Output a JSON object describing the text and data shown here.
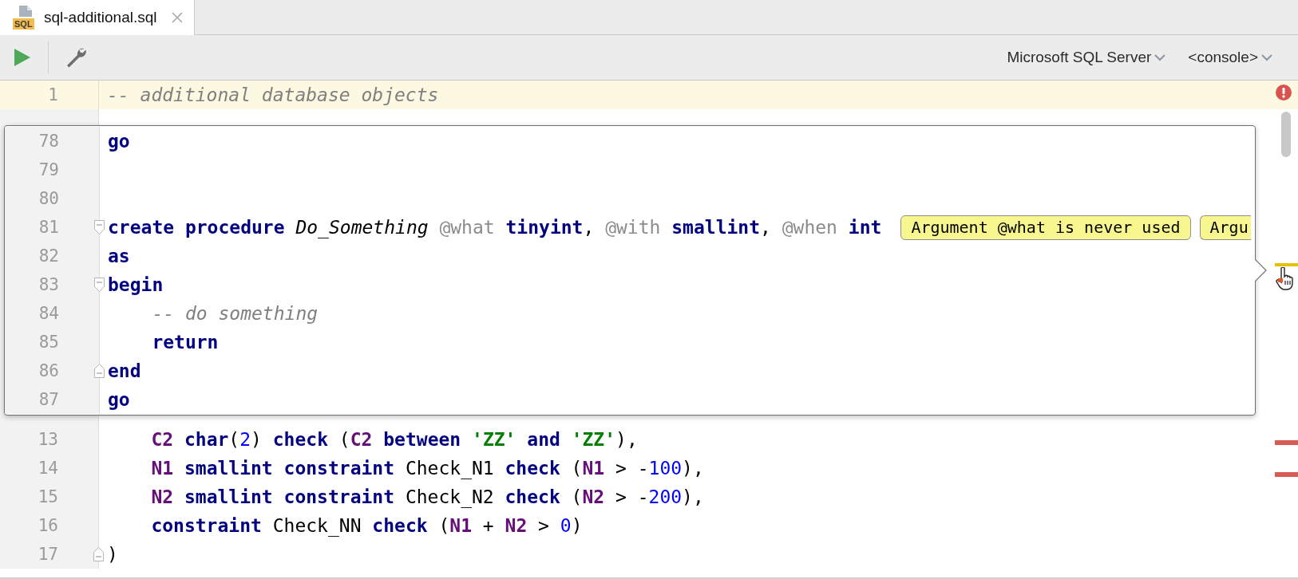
{
  "tab": {
    "title": "sql-additional.sql",
    "icon_label": "SQL",
    "selected": true
  },
  "toolbar": {
    "datasource": "Microsoft SQL Server",
    "session": "<console>"
  },
  "editor": {
    "lines_above": [
      {
        "number": "1",
        "current": true,
        "tokens": [
          {
            "kind": "comment",
            "text": "-- additional database objects"
          }
        ]
      }
    ],
    "lines_below": [
      {
        "number": "13",
        "current": false,
        "tokens": [
          {
            "kind": "column",
            "text": "    C2 "
          },
          {
            "kind": "keyword",
            "text": "char"
          },
          {
            "kind": "plain",
            "text": "("
          },
          {
            "kind": "number",
            "text": "2"
          },
          {
            "kind": "plain",
            "text": ") "
          },
          {
            "kind": "keyword",
            "text": "check "
          },
          {
            "kind": "plain",
            "text": "("
          },
          {
            "kind": "column",
            "text": "C2 "
          },
          {
            "kind": "keyword",
            "text": "between "
          },
          {
            "kind": "string",
            "text": "'ZZ' "
          },
          {
            "kind": "keyword",
            "text": "and "
          },
          {
            "kind": "string",
            "text": "'ZZ'"
          },
          {
            "kind": "plain",
            "text": "),"
          }
        ]
      },
      {
        "number": "14",
        "current": false,
        "tokens": [
          {
            "kind": "column",
            "text": "    N1 "
          },
          {
            "kind": "keyword",
            "text": "smallint constraint "
          },
          {
            "kind": "plain",
            "text": "Check_N1 "
          },
          {
            "kind": "keyword",
            "text": "check "
          },
          {
            "kind": "plain",
            "text": "("
          },
          {
            "kind": "column",
            "text": "N1 "
          },
          {
            "kind": "plain",
            "text": "> -"
          },
          {
            "kind": "number",
            "text": "100"
          },
          {
            "kind": "plain",
            "text": "),"
          }
        ]
      },
      {
        "number": "15",
        "current": false,
        "tokens": [
          {
            "kind": "column",
            "text": "    N2 "
          },
          {
            "kind": "keyword",
            "text": "smallint constraint "
          },
          {
            "kind": "plain",
            "text": "Check_N2 "
          },
          {
            "kind": "keyword",
            "text": "check "
          },
          {
            "kind": "plain",
            "text": "("
          },
          {
            "kind": "column",
            "text": "N2 "
          },
          {
            "kind": "plain",
            "text": "> -"
          },
          {
            "kind": "number",
            "text": "200"
          },
          {
            "kind": "plain",
            "text": "),"
          }
        ]
      },
      {
        "number": "16",
        "current": false,
        "tokens": [
          {
            "kind": "keyword",
            "text": "    constraint "
          },
          {
            "kind": "plain",
            "text": "Check_NN "
          },
          {
            "kind": "keyword",
            "text": "check "
          },
          {
            "kind": "plain",
            "text": "("
          },
          {
            "kind": "column",
            "text": "N1 "
          },
          {
            "kind": "plain",
            "text": "+ "
          },
          {
            "kind": "column",
            "text": "N2 "
          },
          {
            "kind": "plain",
            "text": "> "
          },
          {
            "kind": "number",
            "text": "0"
          },
          {
            "kind": "plain",
            "text": ")"
          }
        ]
      },
      {
        "number": "17",
        "current": false,
        "fold_end": true,
        "tokens": [
          {
            "kind": "plain",
            "text": ")"
          }
        ]
      }
    ],
    "marker_stripes": [
      {
        "kind": "warning"
      },
      {
        "kind": "error"
      },
      {
        "kind": "error"
      }
    ]
  },
  "popup": {
    "lines": [
      {
        "number": "78",
        "tokens": [
          {
            "kind": "keyword",
            "text": "go"
          }
        ]
      },
      {
        "number": "79"
      },
      {
        "number": "80"
      },
      {
        "number": "81",
        "fold_start": true,
        "tokens": [
          {
            "kind": "keyword",
            "text": "create procedure "
          },
          {
            "kind": "routine",
            "text": "Do_Something "
          },
          {
            "kind": "variable",
            "text": "@what "
          },
          {
            "kind": "keyword",
            "text": "tinyint"
          },
          {
            "kind": "plain",
            "text": ", "
          },
          {
            "kind": "variable",
            "text": "@with "
          },
          {
            "kind": "keyword",
            "text": "smallint"
          },
          {
            "kind": "plain",
            "text": ", "
          },
          {
            "kind": "variable",
            "text": "@when "
          },
          {
            "kind": "keyword",
            "text": "int"
          }
        ],
        "hints": [
          {
            "text": "Argument @what is never used",
            "cut_off": false
          },
          {
            "text": "Argu",
            "cut_off": true
          }
        ]
      },
      {
        "number": "82",
        "tokens": [
          {
            "kind": "keyword",
            "text": "as"
          }
        ]
      },
      {
        "number": "83",
        "fold_start": true,
        "tokens": [
          {
            "kind": "keyword",
            "text": "begin"
          }
        ]
      },
      {
        "number": "84",
        "tokens": [
          {
            "kind": "comment",
            "text": "    -- do something"
          }
        ]
      },
      {
        "number": "85",
        "tokens": [
          {
            "kind": "keyword",
            "text": "    return"
          }
        ]
      },
      {
        "number": "86",
        "fold_end": true,
        "tokens": [
          {
            "kind": "keyword",
            "text": "end"
          }
        ]
      },
      {
        "number": "87",
        "tokens": [
          {
            "kind": "keyword",
            "text": "go"
          }
        ]
      }
    ]
  }
}
